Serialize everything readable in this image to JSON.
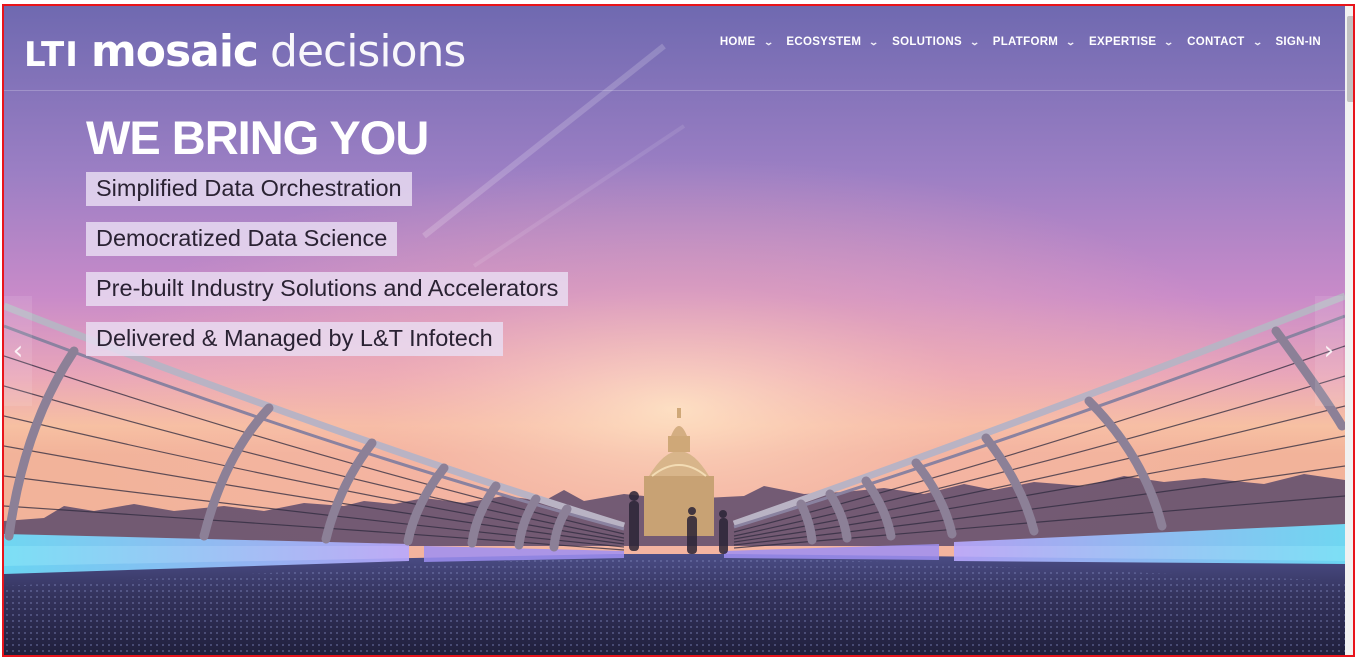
{
  "brand": {
    "part1": "LTI",
    "part2": "mosaic",
    "part3": "decisions"
  },
  "nav": {
    "items": [
      {
        "label": "HOME",
        "dropdown": true
      },
      {
        "label": "ECOSYSTEM",
        "dropdown": true
      },
      {
        "label": "SOLUTIONS",
        "dropdown": true
      },
      {
        "label": "PLATFORM",
        "dropdown": true
      },
      {
        "label": "EXPERTISE",
        "dropdown": true
      },
      {
        "label": "CONTACT",
        "dropdown": true
      },
      {
        "label": "SIGN-IN",
        "dropdown": false
      }
    ],
    "chevron_glyph": "⌄"
  },
  "hero": {
    "headline": "WE BRING YOU",
    "features": [
      "Simplified Data Orchestration",
      "Democratized Data Science",
      "Pre-built Industry Solutions and Accelerators",
      "Delivered & Managed by L&T Infotech"
    ],
    "prev_arrow": "‹",
    "next_arrow": "›"
  },
  "colors": {
    "frame": "#e8141b",
    "sky_top": "#7a6fb5",
    "sky_mid": "#c58ad0",
    "horizon": "#f3b5a8",
    "deck_light": "#7fe3f7",
    "feature_bg": "#e9def3"
  },
  "icons": {
    "nav_dropdown": "chevron-down-icon",
    "carousel_prev": "chevron-left-icon",
    "carousel_next": "chevron-right-icon"
  }
}
